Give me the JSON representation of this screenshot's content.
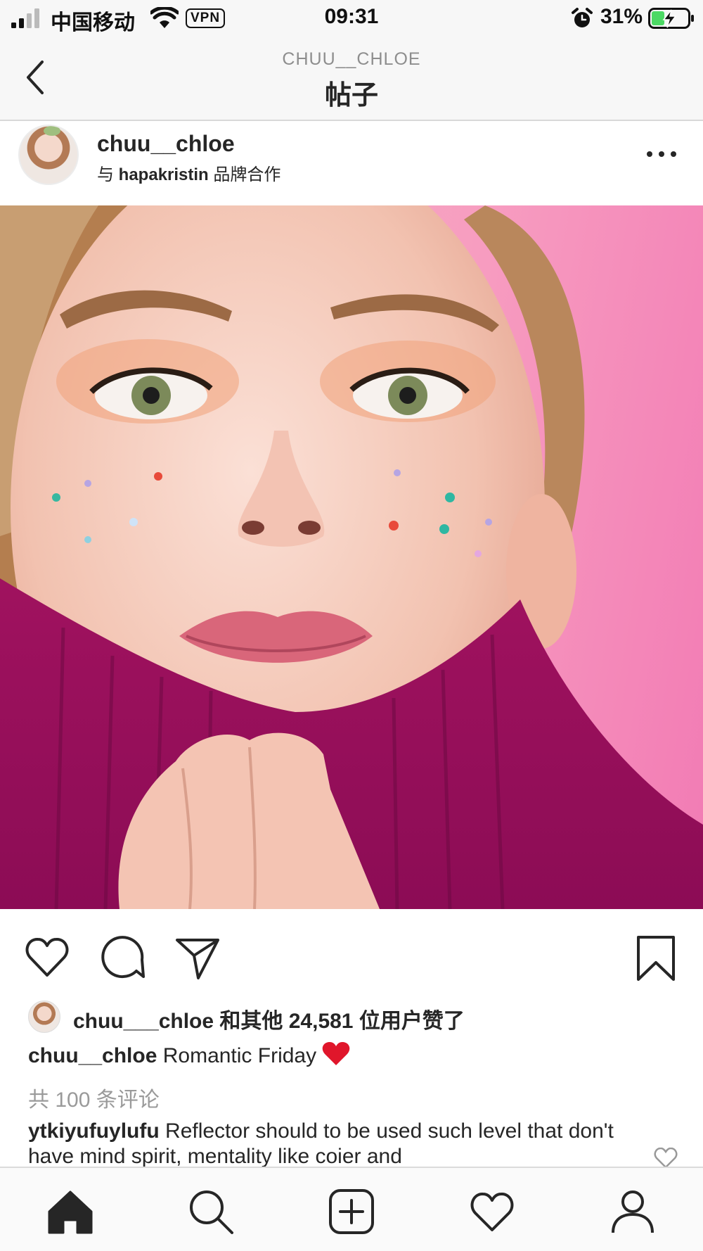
{
  "status_bar": {
    "carrier": "中国移动",
    "vpn": "VPN",
    "time": "09:31",
    "battery": "31%",
    "icons": [
      "signal-icon",
      "wifi-icon",
      "alarm-icon",
      "battery-charging-icon"
    ]
  },
  "header": {
    "subtitle": "CHUU__CHLOE",
    "title": "帖子",
    "back_icon": "chevron-left-icon"
  },
  "post": {
    "username": "chuu__chloe",
    "partnership_prefix": "与 ",
    "partnership_brand": "hapakristin",
    "partnership_suffix": " 品牌合作",
    "more_icon": "more-horizontal-icon",
    "image": "portrait photo on pink background"
  },
  "actions": {
    "icons": [
      "heart-icon",
      "comment-icon",
      "share-icon",
      "bookmark-icon"
    ]
  },
  "likes": {
    "text": "chuu___chloe 和其他 24,581 位用户赞了"
  },
  "caption": {
    "username": "chuu__chloe",
    "text": " Romantic Friday",
    "emoji": "red-heart"
  },
  "comments": {
    "view_all": "共 100 条评论",
    "first": {
      "username": "ytkiyufuylufu",
      "text": " Reflector should to be used such level that don't have mind spirit, mentality like coier and"
    }
  },
  "tab_bar": {
    "tabs": [
      "home-icon",
      "search-icon",
      "new-post-icon",
      "activity-icon",
      "profile-icon"
    ]
  },
  "colors": {
    "text": "#262626",
    "muted": "#8e8e8e",
    "heart_red": "#e0162b",
    "bar_bg": "#f7f7f7"
  }
}
